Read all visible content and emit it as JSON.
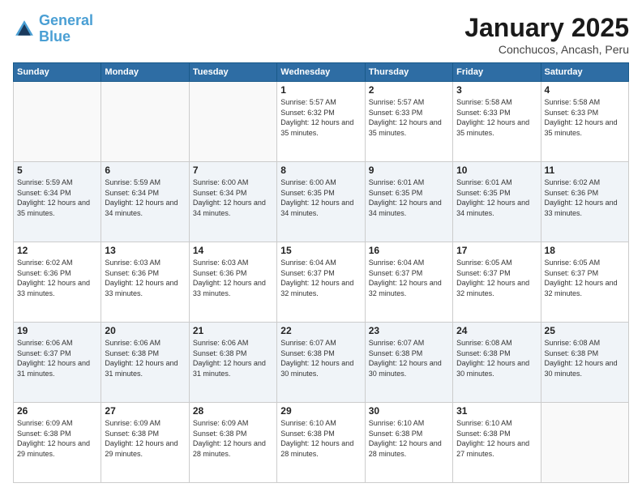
{
  "logo": {
    "line1": "General",
    "line2": "Blue"
  },
  "title": "January 2025",
  "location": "Conchucos, Ancash, Peru",
  "weekdays": [
    "Sunday",
    "Monday",
    "Tuesday",
    "Wednesday",
    "Thursday",
    "Friday",
    "Saturday"
  ],
  "weeks": [
    [
      {
        "day": "",
        "info": ""
      },
      {
        "day": "",
        "info": ""
      },
      {
        "day": "",
        "info": ""
      },
      {
        "day": "1",
        "info": "Sunrise: 5:57 AM\nSunset: 6:32 PM\nDaylight: 12 hours and 35 minutes."
      },
      {
        "day": "2",
        "info": "Sunrise: 5:57 AM\nSunset: 6:33 PM\nDaylight: 12 hours and 35 minutes."
      },
      {
        "day": "3",
        "info": "Sunrise: 5:58 AM\nSunset: 6:33 PM\nDaylight: 12 hours and 35 minutes."
      },
      {
        "day": "4",
        "info": "Sunrise: 5:58 AM\nSunset: 6:33 PM\nDaylight: 12 hours and 35 minutes."
      }
    ],
    [
      {
        "day": "5",
        "info": "Sunrise: 5:59 AM\nSunset: 6:34 PM\nDaylight: 12 hours and 35 minutes."
      },
      {
        "day": "6",
        "info": "Sunrise: 5:59 AM\nSunset: 6:34 PM\nDaylight: 12 hours and 34 minutes."
      },
      {
        "day": "7",
        "info": "Sunrise: 6:00 AM\nSunset: 6:34 PM\nDaylight: 12 hours and 34 minutes."
      },
      {
        "day": "8",
        "info": "Sunrise: 6:00 AM\nSunset: 6:35 PM\nDaylight: 12 hours and 34 minutes."
      },
      {
        "day": "9",
        "info": "Sunrise: 6:01 AM\nSunset: 6:35 PM\nDaylight: 12 hours and 34 minutes."
      },
      {
        "day": "10",
        "info": "Sunrise: 6:01 AM\nSunset: 6:35 PM\nDaylight: 12 hours and 34 minutes."
      },
      {
        "day": "11",
        "info": "Sunrise: 6:02 AM\nSunset: 6:36 PM\nDaylight: 12 hours and 33 minutes."
      }
    ],
    [
      {
        "day": "12",
        "info": "Sunrise: 6:02 AM\nSunset: 6:36 PM\nDaylight: 12 hours and 33 minutes."
      },
      {
        "day": "13",
        "info": "Sunrise: 6:03 AM\nSunset: 6:36 PM\nDaylight: 12 hours and 33 minutes."
      },
      {
        "day": "14",
        "info": "Sunrise: 6:03 AM\nSunset: 6:36 PM\nDaylight: 12 hours and 33 minutes."
      },
      {
        "day": "15",
        "info": "Sunrise: 6:04 AM\nSunset: 6:37 PM\nDaylight: 12 hours and 32 minutes."
      },
      {
        "day": "16",
        "info": "Sunrise: 6:04 AM\nSunset: 6:37 PM\nDaylight: 12 hours and 32 minutes."
      },
      {
        "day": "17",
        "info": "Sunrise: 6:05 AM\nSunset: 6:37 PM\nDaylight: 12 hours and 32 minutes."
      },
      {
        "day": "18",
        "info": "Sunrise: 6:05 AM\nSunset: 6:37 PM\nDaylight: 12 hours and 32 minutes."
      }
    ],
    [
      {
        "day": "19",
        "info": "Sunrise: 6:06 AM\nSunset: 6:37 PM\nDaylight: 12 hours and 31 minutes."
      },
      {
        "day": "20",
        "info": "Sunrise: 6:06 AM\nSunset: 6:38 PM\nDaylight: 12 hours and 31 minutes."
      },
      {
        "day": "21",
        "info": "Sunrise: 6:06 AM\nSunset: 6:38 PM\nDaylight: 12 hours and 31 minutes."
      },
      {
        "day": "22",
        "info": "Sunrise: 6:07 AM\nSunset: 6:38 PM\nDaylight: 12 hours and 30 minutes."
      },
      {
        "day": "23",
        "info": "Sunrise: 6:07 AM\nSunset: 6:38 PM\nDaylight: 12 hours and 30 minutes."
      },
      {
        "day": "24",
        "info": "Sunrise: 6:08 AM\nSunset: 6:38 PM\nDaylight: 12 hours and 30 minutes."
      },
      {
        "day": "25",
        "info": "Sunrise: 6:08 AM\nSunset: 6:38 PM\nDaylight: 12 hours and 30 minutes."
      }
    ],
    [
      {
        "day": "26",
        "info": "Sunrise: 6:09 AM\nSunset: 6:38 PM\nDaylight: 12 hours and 29 minutes."
      },
      {
        "day": "27",
        "info": "Sunrise: 6:09 AM\nSunset: 6:38 PM\nDaylight: 12 hours and 29 minutes."
      },
      {
        "day": "28",
        "info": "Sunrise: 6:09 AM\nSunset: 6:38 PM\nDaylight: 12 hours and 28 minutes."
      },
      {
        "day": "29",
        "info": "Sunrise: 6:10 AM\nSunset: 6:38 PM\nDaylight: 12 hours and 28 minutes."
      },
      {
        "day": "30",
        "info": "Sunrise: 6:10 AM\nSunset: 6:38 PM\nDaylight: 12 hours and 28 minutes."
      },
      {
        "day": "31",
        "info": "Sunrise: 6:10 AM\nSunset: 6:38 PM\nDaylight: 12 hours and 27 minutes."
      },
      {
        "day": "",
        "info": ""
      }
    ]
  ]
}
